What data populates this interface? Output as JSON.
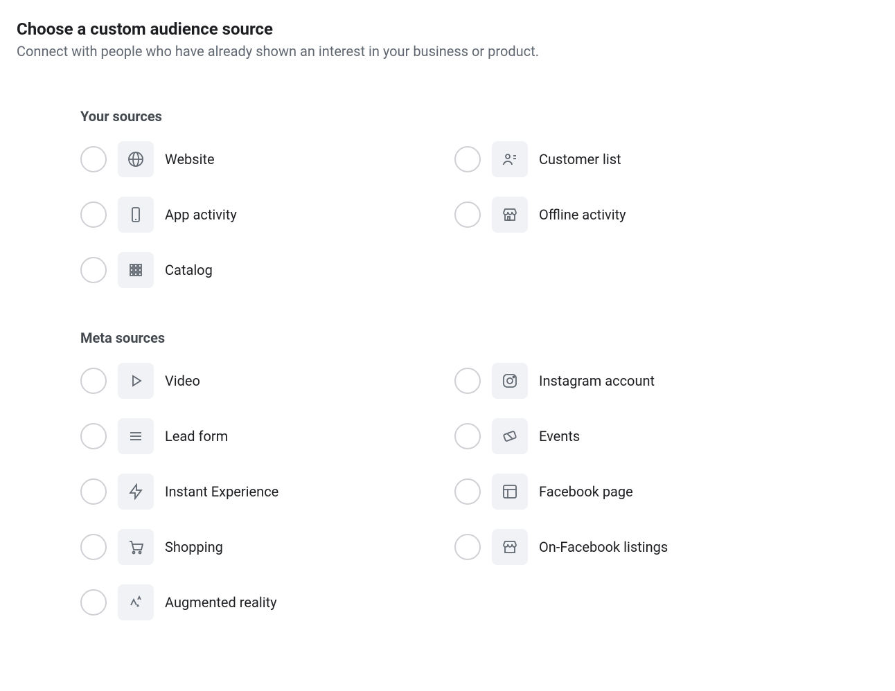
{
  "header": {
    "title": "Choose a custom audience source",
    "subtitle": "Connect with people who have already shown an interest in your business or product."
  },
  "sections": {
    "your_sources": {
      "title": "Your sources",
      "items": [
        {
          "label": "Website",
          "icon": "globe-icon"
        },
        {
          "label": "Customer list",
          "icon": "person-list-icon"
        },
        {
          "label": "App activity",
          "icon": "phone-icon"
        },
        {
          "label": "Offline activity",
          "icon": "store-icon"
        },
        {
          "label": "Catalog",
          "icon": "grid-icon"
        }
      ]
    },
    "meta_sources": {
      "title": "Meta sources",
      "items": [
        {
          "label": "Video",
          "icon": "play-icon"
        },
        {
          "label": "Instagram account",
          "icon": "instagram-icon"
        },
        {
          "label": "Lead form",
          "icon": "list-icon"
        },
        {
          "label": "Events",
          "icon": "ticket-icon"
        },
        {
          "label": "Instant Experience",
          "icon": "lightning-icon"
        },
        {
          "label": "Facebook page",
          "icon": "layout-icon"
        },
        {
          "label": "Shopping",
          "icon": "cart-icon"
        },
        {
          "label": "On-Facebook listings",
          "icon": "storefront-icon"
        },
        {
          "label": "Augmented reality",
          "icon": "sparkle-icon"
        }
      ]
    }
  }
}
